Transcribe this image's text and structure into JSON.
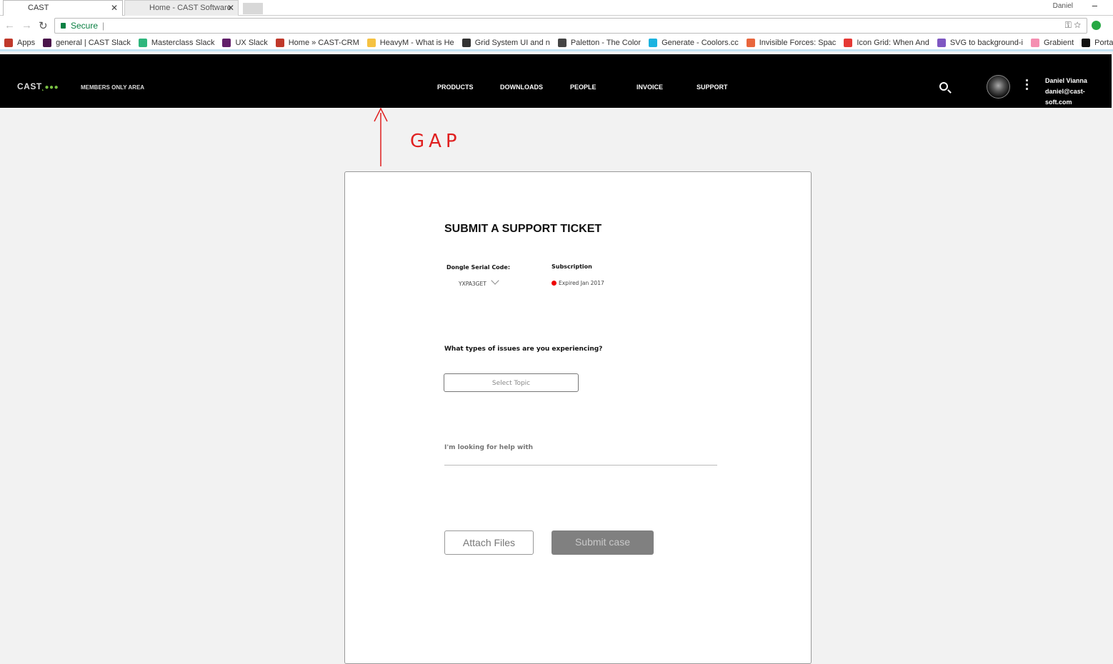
{
  "browser": {
    "tabs": [
      {
        "label": "CAST",
        "active": true
      },
      {
        "label": "Home - CAST Software",
        "active": false
      }
    ],
    "user": "Daniel",
    "address": {
      "secure_label": "Secure",
      "url": ""
    },
    "bookmarks": [
      {
        "label": "Apps",
        "color": "#c0392b"
      },
      {
        "label": "general | CAST Slack",
        "color": "#4a154b"
      },
      {
        "label": "Masterclass Slack",
        "color": "#2eb67d"
      },
      {
        "label": "UX Slack",
        "color": "#611f69"
      },
      {
        "label": "Home » CAST-CRM",
        "color": "#c0392b"
      },
      {
        "label": "HeavyM - What is He",
        "color": "#f5c242"
      },
      {
        "label": "Grid System UI and n",
        "color": "#333333"
      },
      {
        "label": "Paletton - The Color",
        "color": "#444444"
      },
      {
        "label": "Generate - Coolors.cc",
        "color": "#1bb3e0"
      },
      {
        "label": "Invisible Forces: Spac",
        "color": "#e8663d"
      },
      {
        "label": "Icon Grid: When And",
        "color": "#e53935"
      },
      {
        "label": "SVG to background-i",
        "color": "#7e57c2"
      },
      {
        "label": "Grabient",
        "color": "#f48fb1"
      },
      {
        "label": "Porta Estel·lar |",
        "color": "#111111"
      }
    ]
  },
  "header": {
    "logo": "CAST",
    "area": "MEMBERS ONLY AREA",
    "menu": [
      "PRODUCTS",
      "DOWNLOADS",
      "PEOPLE",
      "INVOICE",
      "SUPPORT"
    ],
    "user_name": "Daniel Vianna",
    "user_email": "daniel@cast-soft.com",
    "accent": "#7ac143"
  },
  "annotation": {
    "text": "GAP",
    "color": "#e02020"
  },
  "form": {
    "title": "SUBMIT A SUPPORT TICKET",
    "dongle_label": "Dongle Serial Code:",
    "dongle_value": "YXPA3GET",
    "subscription_label": "Subscription",
    "subscription_status": "Expired Jan 2017",
    "status_color": "#e00000",
    "question": "What types of issues are you experiencing?",
    "topic_placeholder": "Select Topic",
    "help_placeholder": "I'm looking for help with",
    "attach_label": "Attach Files",
    "submit_label": "Submit case"
  }
}
